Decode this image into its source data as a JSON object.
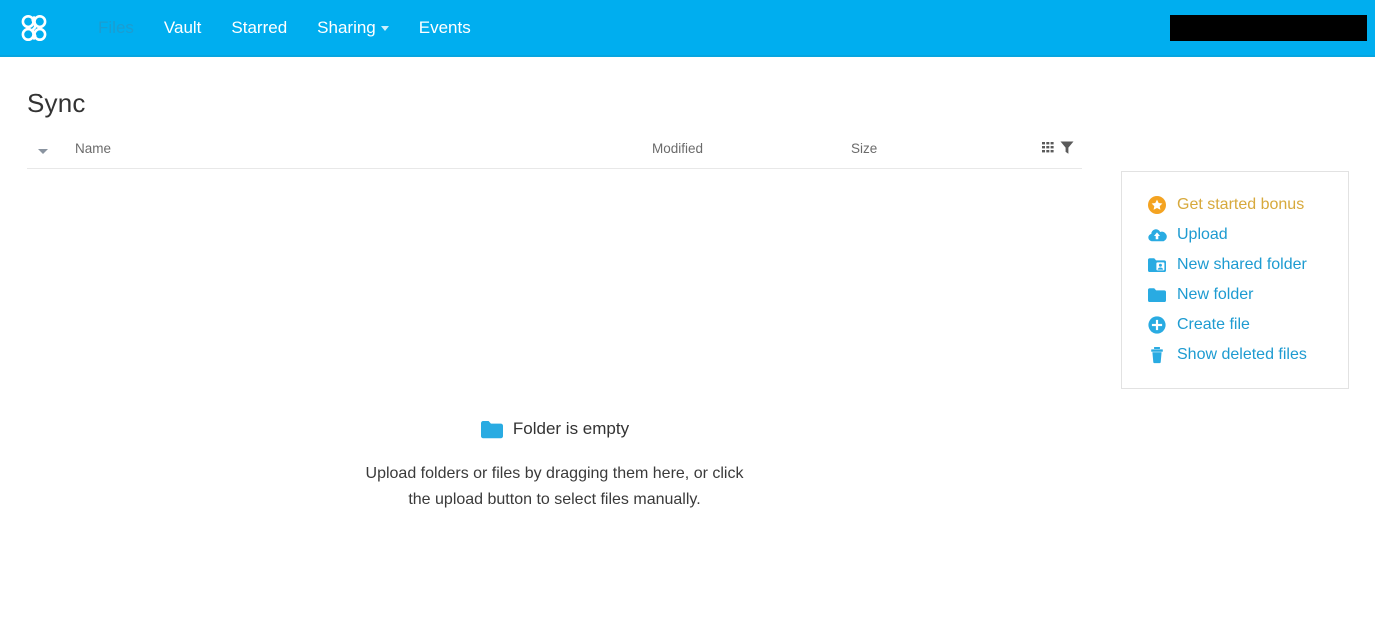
{
  "colors": {
    "brand_blue": "#00aeef",
    "link_blue": "#1d9bd1",
    "icon_blue": "#29abe2",
    "bonus_orange": "#f4a321",
    "bonus_text": "#d7a93c",
    "redaction": "#000000",
    "text_dark": "#333333",
    "text_muted": "#6b6b6b"
  },
  "navbar": {
    "logo_icon": "seafile-cloud-logo-icon",
    "items": [
      {
        "label": "Files",
        "icon": "",
        "active": true,
        "has_caret": false
      },
      {
        "label": "Vault",
        "icon": "",
        "active": false,
        "has_caret": false
      },
      {
        "label": "Starred",
        "icon": "",
        "active": false,
        "has_caret": false
      },
      {
        "label": "Sharing",
        "icon": "chevron-down-icon",
        "active": false,
        "has_caret": true
      },
      {
        "label": "Events",
        "icon": "",
        "active": false,
        "has_caret": false
      }
    ],
    "account_redacted": ""
  },
  "page": {
    "title": "Sync"
  },
  "filelist": {
    "sort_caret_icon": "caret-down-icon",
    "columns": [
      {
        "key": "name",
        "label": "Name"
      },
      {
        "key": "modified",
        "label": "Modified"
      },
      {
        "key": "size",
        "label": "Size"
      }
    ],
    "tools": [
      {
        "name": "grid-view-icon",
        "label": ""
      },
      {
        "name": "filter-icon",
        "label": ""
      }
    ],
    "rows": []
  },
  "empty_state": {
    "folder_icon": "folder-icon",
    "title": "Folder is empty",
    "line1": "Upload folders or files by dragging them here, or click",
    "line2": "the upload button to select files manually."
  },
  "side_panel": {
    "operations": [
      {
        "label": "Get started bonus",
        "icon": "star-circle-icon",
        "style": "bonus"
      },
      {
        "label": "Upload",
        "icon": "cloud-upload-icon",
        "style": "link"
      },
      {
        "label": "New shared folder",
        "icon": "shared-folder-icon",
        "style": "link"
      },
      {
        "label": "New folder",
        "icon": "folder-icon",
        "style": "link"
      },
      {
        "label": "Create file",
        "icon": "plus-circle-icon",
        "style": "link"
      },
      {
        "label": "Show deleted files",
        "icon": "trash-icon",
        "style": "link"
      }
    ]
  }
}
